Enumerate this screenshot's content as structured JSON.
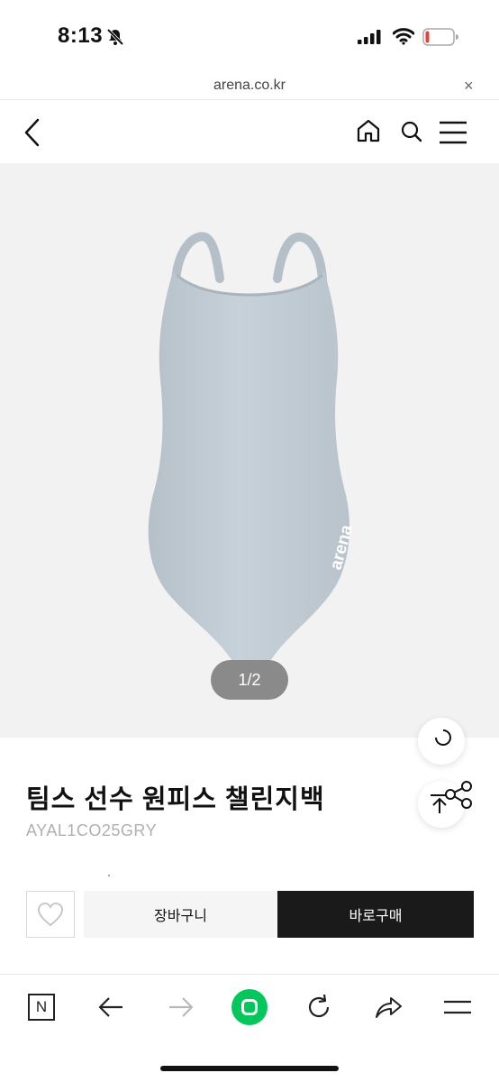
{
  "status_bar": {
    "time": "8:13"
  },
  "url_bar": {
    "domain": "arena.co.kr",
    "close": "×"
  },
  "product": {
    "page_indicator": "1/2",
    "brand_print": "arena",
    "title": "팀스 선수 원피스 챌린지백",
    "code": "AYAL1CO25GRY",
    "swimsuit_color": "#c3cdd6"
  },
  "actions": {
    "cart_label": "장바구니",
    "buy_label": "바로구매"
  },
  "bottom_nav": {
    "naver_label": "N"
  },
  "icons": [
    "bell-slash-icon",
    "signal-icon",
    "wifi-icon",
    "battery-icon",
    "back-icon",
    "home-icon",
    "search-icon",
    "hamburger-icon",
    "share-icon",
    "heart-icon",
    "forward-icon",
    "refresh-icon",
    "share-arrow-icon"
  ]
}
